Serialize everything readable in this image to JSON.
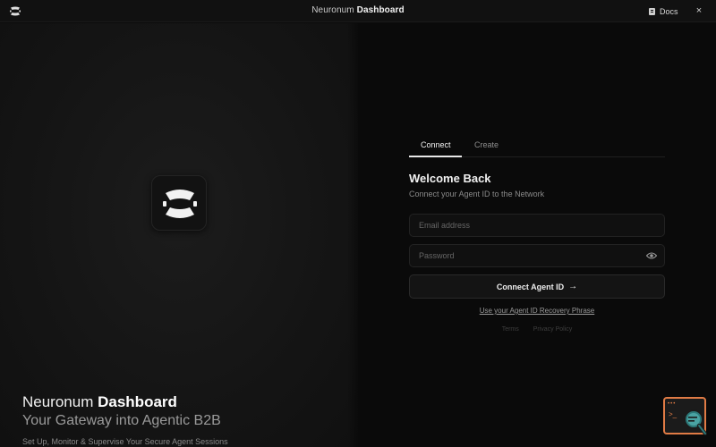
{
  "window": {
    "title_prefix": "Neuronum",
    "title_bold": "Dashboard",
    "docs_label": "Docs",
    "close_glyph": "×"
  },
  "hero": {
    "title_prefix": "Neuronum",
    "title_bold": "Dashboard",
    "subtitle": "Your Gateway into Agentic B2B",
    "tagline": "Set Up, Monitor & Supervise Your Secure Agent Sessions"
  },
  "auth": {
    "tabs": [
      {
        "label": "Connect",
        "active": true
      },
      {
        "label": "Create",
        "active": false
      }
    ],
    "welcome_title": "Welcome Back",
    "welcome_subtitle": "Connect your Agent ID to the Network",
    "email": {
      "placeholder": "Email address",
      "value": ""
    },
    "password": {
      "placeholder": "Password",
      "value": ""
    },
    "connect_label": "Connect Agent ID",
    "arrow_glyph": "→",
    "recovery_link": "Use your Agent ID Recovery Phrase",
    "footer_links": {
      "terms": "Terms",
      "privacy": "Privacy Policy"
    }
  },
  "widget": {
    "dots": "•••",
    "prompt": ">_"
  },
  "colors": {
    "background": "#0a0a0a",
    "left_panel": "#151515",
    "accent_widget": "#e07b45",
    "magnifier": "#3a8f8f"
  },
  "icons": {
    "app_logo": "neuronum-logo-icon",
    "docs": "document-icon",
    "close": "close-icon",
    "eye": "eye-icon",
    "arrow": "arrow-right-icon",
    "widget": "terminal-search-icon"
  }
}
